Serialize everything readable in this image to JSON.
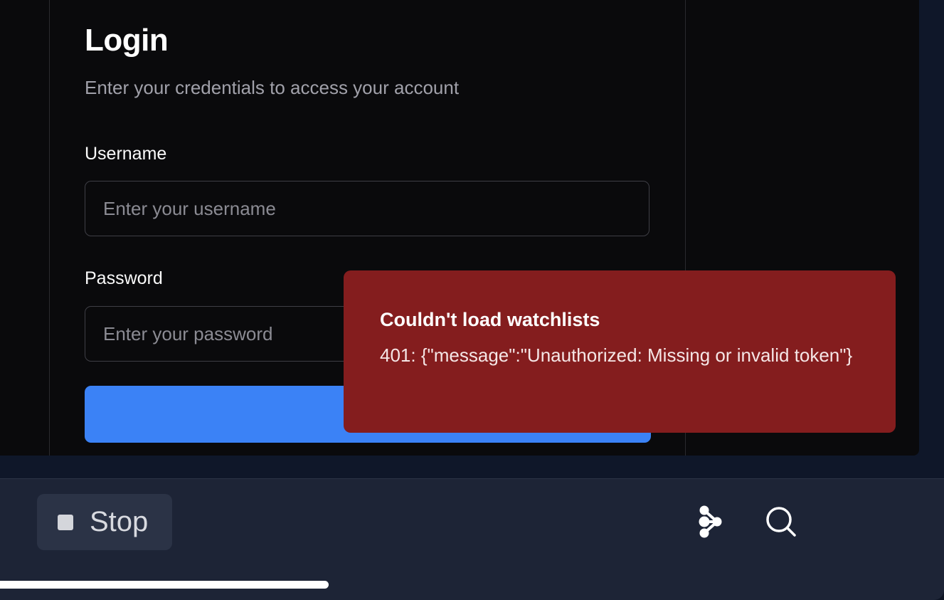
{
  "login": {
    "title": "Login",
    "subtitle": "Enter your credentials to access your account",
    "username_label": "Username",
    "username_placeholder": "Enter your username",
    "username_value": "",
    "password_label": "Password",
    "password_placeholder": "Enter your password",
    "password_value": "",
    "submit_color": "#3b82f6"
  },
  "toast": {
    "title": "Couldn't load watchlists",
    "message": "401: {\"message\":\"Unauthorized: Missing or invalid token\"}",
    "color": "#841d1e"
  },
  "bottom_bar": {
    "stop_label": "Stop",
    "stop_icon": "stop-square-icon",
    "share_icon": "share-nodes-icon",
    "search_icon": "search-icon",
    "progress_fraction": 0.348
  }
}
